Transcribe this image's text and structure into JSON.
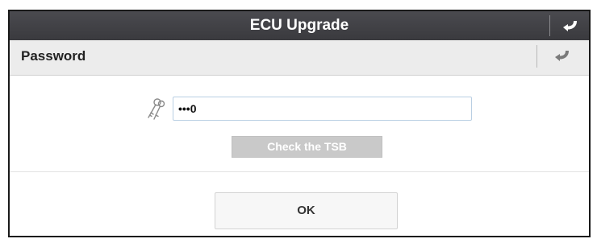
{
  "window": {
    "title": "ECU Upgrade",
    "back_icon": "back-arrow-icon"
  },
  "subheader": {
    "label": "Password",
    "back_icon": "back-arrow-icon"
  },
  "password": {
    "icon": "keys-icon",
    "value": "•••0"
  },
  "buttons": {
    "check_tsb": "Check the TSB",
    "ok": "OK"
  },
  "colors": {
    "titlebar": "#3f3f44",
    "subheader": "#ececec",
    "disabled_button": "#c9c9c9",
    "input_border": "#b9cfe3"
  }
}
